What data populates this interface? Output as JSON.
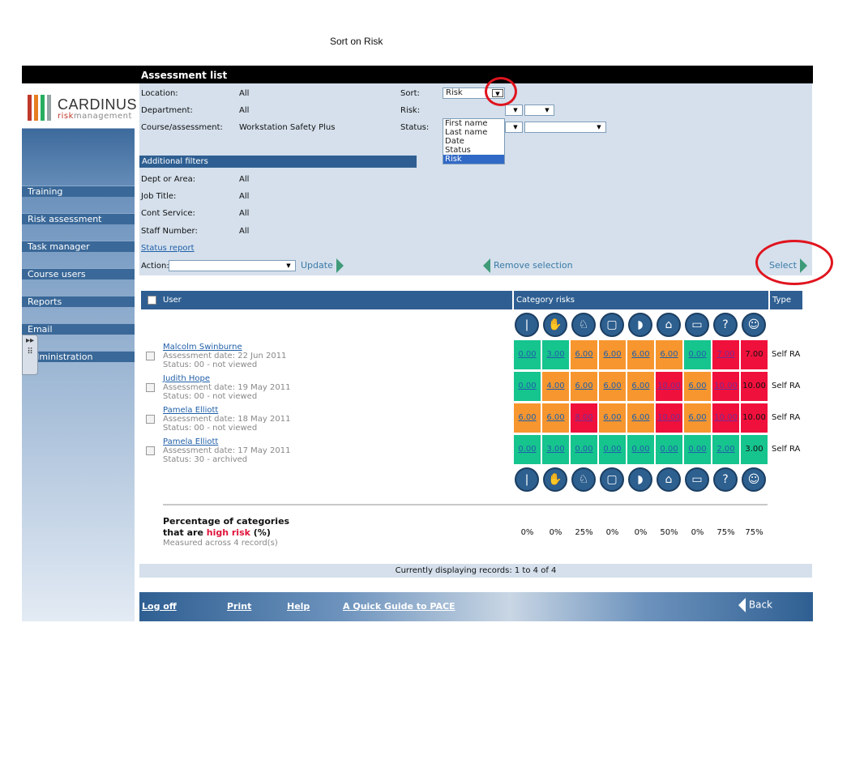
{
  "caption": "Sort on Risk",
  "header": {
    "title": "Assessment list"
  },
  "logo": {
    "name": "CARDINUS",
    "sub_a": "risk",
    "sub_b": "management",
    "bar_colors": [
      "#c0392b",
      "#e67e22",
      "#27ae60",
      "#7f8c8d"
    ]
  },
  "nav": [
    "Training",
    "Risk assessment",
    "Task manager",
    "Course users",
    "Reports",
    "Email",
    "Administration"
  ],
  "filters": {
    "location_label": "Location:",
    "location_value": "All",
    "department_label": "Department:",
    "department_value": "All",
    "course_label": "Course/assessment:",
    "course_value": "Workstation Safety Plus",
    "sort_label": "Sort:",
    "sort_value": "Risk",
    "risk_label": "Risk:",
    "status_label": "Status:",
    "sort_options": [
      "First name",
      "Last name",
      "Date",
      "Status",
      "Risk"
    ]
  },
  "additional": {
    "title": "Additional filters",
    "dept_label": "Dept or Area:",
    "dept_value": "All",
    "job_label": "Job Title:",
    "job_value": "All",
    "cont_label": "Cont Service:",
    "cont_value": "All",
    "staff_label": "Staff Number:",
    "staff_value": "All",
    "status_report": "Status report"
  },
  "actions": {
    "action_label": "Action:",
    "update": "Update",
    "remove": "Remove selection",
    "select": "Select"
  },
  "table": {
    "col_user": "User",
    "col_risks": "Category risks",
    "col_type": "Type",
    "icons": [
      "spine-icon",
      "hand-icon",
      "chair-icon",
      "monitor-icon",
      "mouse-icon",
      "desk-icon",
      "laptop-icon",
      "question-icon",
      "person-icon"
    ],
    "icon_glyphs": [
      "❘",
      "✋",
      "♘",
      "▢",
      "◗",
      "⌂",
      "▭",
      "?",
      "☺"
    ],
    "rows": [
      {
        "name": "Malcolm Swinburne",
        "date": "Assessment date: 22 Jun 2011",
        "status": "Status: 00 - not viewed",
        "type": "Self RA",
        "cells": [
          "0.00",
          "3.00",
          "6.00",
          "6.00",
          "6.00",
          "6.00",
          "0.00",
          "7.00",
          "7.00"
        ],
        "levels": [
          "g",
          "g",
          "o",
          "o",
          "o",
          "o",
          "g",
          "r",
          "r"
        ]
      },
      {
        "name": "Judith Hope",
        "date": "Assessment date: 19 May 2011",
        "status": "Status: 00 - not viewed",
        "type": "Self RA",
        "cells": [
          "0.00",
          "4.00",
          "6.00",
          "6.00",
          "6.00",
          "10.00",
          "6.00",
          "10.00",
          "10.00"
        ],
        "levels": [
          "g",
          "o",
          "o",
          "o",
          "o",
          "r",
          "o",
          "r",
          "r"
        ]
      },
      {
        "name": "Pamela Elliott",
        "date": "Assessment date: 18 May 2011",
        "status": "Status: 00 - not viewed",
        "type": "Self RA",
        "cells": [
          "6.00",
          "6.00",
          "8.00",
          "6.00",
          "6.00",
          "10.00",
          "6.00",
          "10.00",
          "10.00"
        ],
        "levels": [
          "o",
          "o",
          "r",
          "o",
          "o",
          "r",
          "o",
          "r",
          "r"
        ]
      },
      {
        "name": "Pamela Elliott",
        "date": "Assessment date: 17 May 2011",
        "status": "Status: 30 - archived",
        "type": "Self RA",
        "cells": [
          "0.00",
          "3.00",
          "0.00",
          "0.00",
          "0.00",
          "0.00",
          "0.00",
          "2.00",
          "3.00"
        ],
        "levels": [
          "g",
          "g",
          "g",
          "g",
          "g",
          "g",
          "g",
          "g",
          "g"
        ]
      }
    ],
    "colors": {
      "g": "#16c48e",
      "o": "#f7962f",
      "r": "#f0103c"
    }
  },
  "summary": {
    "line1": "Percentage of categories",
    "line2a": "that are ",
    "line2b": "high risk",
    "line2c": " (%)",
    "measured": "Measured across 4 record(s)",
    "values": [
      "0%",
      "0%",
      "25%",
      "0%",
      "0%",
      "50%",
      "0%",
      "75%",
      "75%"
    ]
  },
  "records": "Currently displaying records: 1 to 4 of 4",
  "footer": {
    "logoff": "Log off",
    "print": "Print",
    "help": "Help",
    "guide": "A Quick Guide to PACE",
    "back": "Back"
  }
}
